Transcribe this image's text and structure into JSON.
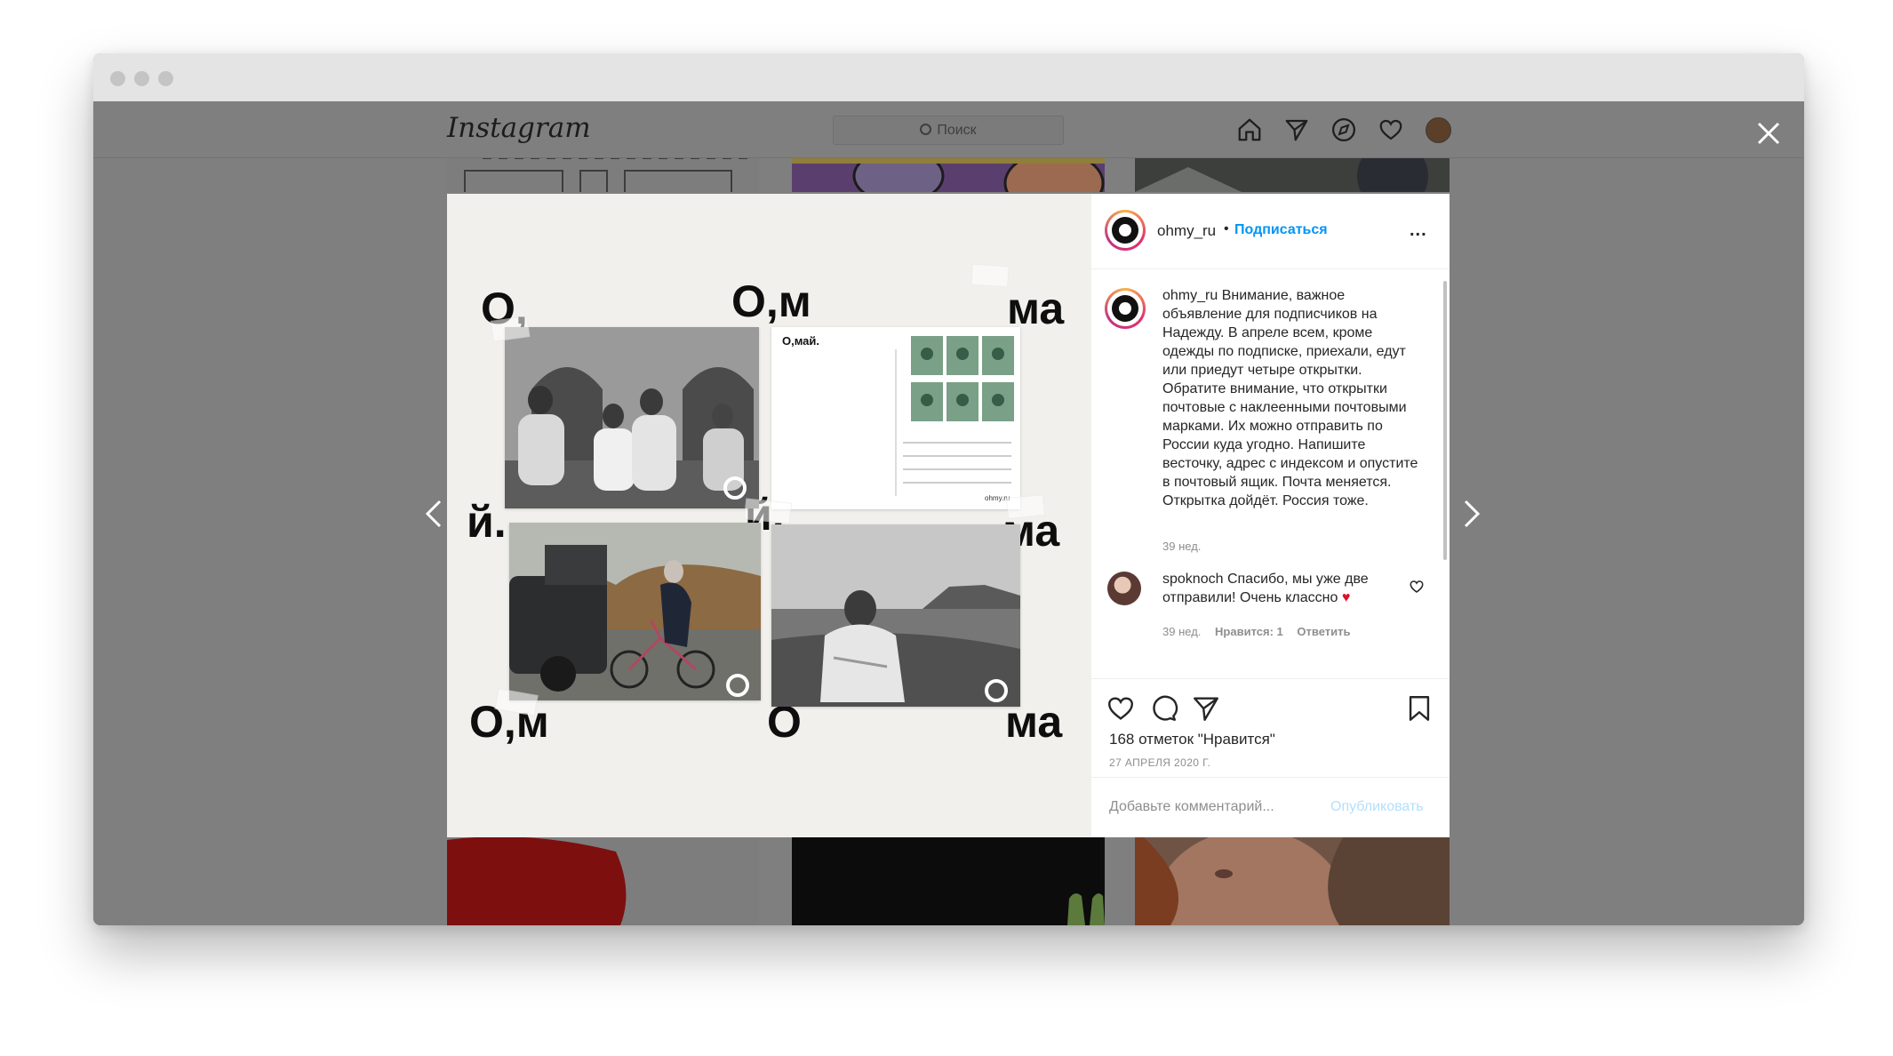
{
  "app": {
    "logo_text": "Instagram",
    "search_placeholder": "Поиск"
  },
  "nav": {
    "icons": [
      "home-icon",
      "direct-icon",
      "explore-icon",
      "activity-icon",
      "profile-avatar"
    ]
  },
  "post": {
    "author": "ohmy_ru",
    "separator": "•",
    "follow_label": "Подписаться",
    "more_label": "...",
    "caption_author": "ohmy_ru",
    "caption": "Внимание, важное объявление для подписчиков на Надежду. В апреле всем, кроме одежды по подписке, приехали, едут или приедут четыре открытки. Обратите внимание, что открытки почтовые с наклеенными почтовыми марками. Их можно отправить по России куда угодно. Напишите весточку, адрес с индексом и опустите в почтовый ящик. Почта меняется. Открытка дойдёт. Россия тоже.",
    "caption_age": "39 нед.",
    "comments": [
      {
        "author": "spoknoch",
        "text": "Спасибо, мы уже две отправили! Очень классно",
        "emoji": "♥",
        "age": "39 нед.",
        "likes": "Нравится: 1",
        "reply": "Ответить"
      }
    ],
    "likes_text": "168 отметок \"Нравится\"",
    "date": "27 АПРЕЛЯ 2020 Г.",
    "comment_placeholder": "Добавьте комментарий...",
    "publish_label": "Опубликовать"
  },
  "photo": {
    "postcard_title": "О,май.",
    "postcard_site": "ohmy.ru",
    "letters": [
      "О,",
      "О,м",
      "ма",
      "й.",
      "й.",
      "ма",
      "О,м",
      "О",
      "ма"
    ]
  },
  "colors": {
    "link_blue": "#0095f6",
    "publish_disabled": "#b2dffc",
    "text_primary": "#262626",
    "text_secondary": "#8e8e8e",
    "overlay": "#7f7f7f",
    "heart_red": "#e0112b"
  }
}
